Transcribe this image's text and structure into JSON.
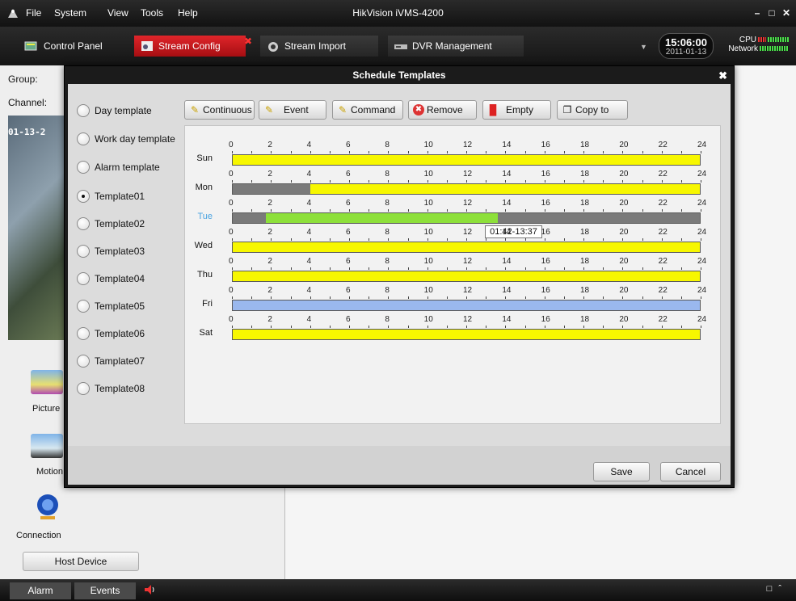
{
  "titlebar": {
    "menus": [
      "File",
      "System",
      "View",
      "Tools",
      "Help"
    ],
    "title": "HikVision iVMS-4200"
  },
  "tabs": [
    {
      "label": "Control Panel",
      "icon": "control-panel-icon"
    },
    {
      "label": "Stream Config",
      "icon": "stream-config-icon",
      "active": true
    },
    {
      "label": "Stream Import",
      "icon": "stream-import-icon"
    },
    {
      "label": "DVR Management",
      "icon": "dvr-icon"
    }
  ],
  "clock": {
    "time": "15:06:00",
    "date": "2011-01-13"
  },
  "stats": {
    "cpu": "CPU",
    "network": "Network"
  },
  "background": {
    "group_label": "Group:",
    "channel_label": "Channel:",
    "camera_timestamp": "01-13-2",
    "picture_label": "Picture",
    "motion_label": "Motion",
    "connection_label": "Connection",
    "host_device": "Host Device"
  },
  "statusbar": {
    "alarm": "Alarm",
    "events": "Events"
  },
  "dialog": {
    "title": "Schedule Templates",
    "templates": [
      {
        "label": "Day template",
        "selected": false
      },
      {
        "label": "Work day template",
        "selected": false
      },
      {
        "label": "Alarm template",
        "selected": false
      },
      {
        "label": "Template01",
        "selected": true
      },
      {
        "label": "Template02",
        "selected": false
      },
      {
        "label": "Template03",
        "selected": false
      },
      {
        "label": "Template04",
        "selected": false
      },
      {
        "label": "Template05",
        "selected": false
      },
      {
        "label": "Template06",
        "selected": false
      },
      {
        "label": "Tamplate07",
        "selected": false
      },
      {
        "label": "Template08",
        "selected": false
      }
    ],
    "toolbar": {
      "continuous": "Continuous",
      "event": "Event",
      "command": "Command",
      "remove": "Remove",
      "empty": "Empty",
      "copy_to": "Copy to"
    },
    "hour_ticks": [
      "0",
      "2",
      "4",
      "6",
      "8",
      "10",
      "12",
      "14",
      "16",
      "18",
      "20",
      "22",
      "24"
    ],
    "colors": {
      "continuous": "#f7f700",
      "event": "#8de03a",
      "command": "#9ab8ee",
      "empty": "#7a7a7a"
    },
    "days": [
      {
        "day": "Sun",
        "segments": [
          {
            "start": 0,
            "end": 24,
            "type": "continuous"
          }
        ]
      },
      {
        "day": "Mon",
        "segments": [
          {
            "start": 4,
            "end": 24,
            "type": "continuous"
          }
        ]
      },
      {
        "day": "Tue",
        "highlighted": true,
        "segments": [
          {
            "start": 1.7,
            "end": 13.62,
            "type": "event"
          }
        ]
      },
      {
        "day": "Wed",
        "segments": [
          {
            "start": 0,
            "end": 24,
            "type": "continuous"
          }
        ]
      },
      {
        "day": "Thu",
        "segments": [
          {
            "start": 0,
            "end": 24,
            "type": "continuous"
          }
        ]
      },
      {
        "day": "Fri",
        "segments": [
          {
            "start": 0,
            "end": 24,
            "type": "command"
          }
        ]
      },
      {
        "day": "Sat",
        "segments": [
          {
            "start": 0,
            "end": 24,
            "type": "continuous"
          }
        ]
      }
    ],
    "tooltip": "01:42-13:37",
    "save": "Save",
    "cancel": "Cancel"
  }
}
